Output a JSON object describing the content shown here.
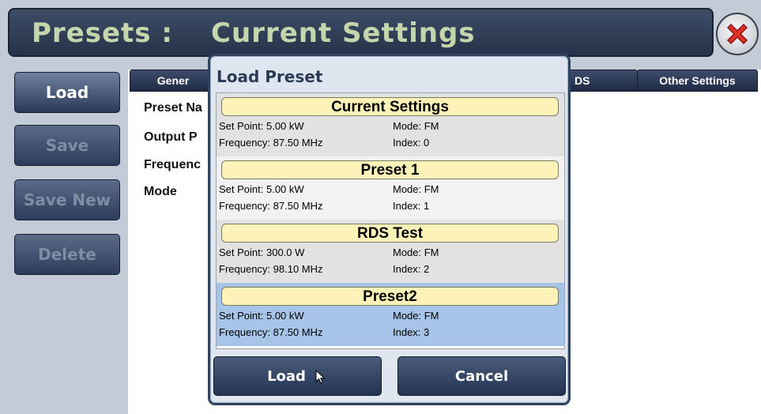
{
  "title": {
    "section": "Presets :",
    "page": "Current Settings"
  },
  "sidebar": {
    "load": "Load",
    "save": "Save",
    "save_new": "Save New",
    "delete": "Delete"
  },
  "tabs": {
    "general": "Gener",
    "rds": "DS",
    "other": "Other Settings"
  },
  "fields": {
    "preset_name": "Preset Na",
    "output_power": "Output P",
    "frequency": "Frequenc",
    "mode": "Mode"
  },
  "dialog": {
    "title": "Load Preset",
    "presets": [
      {
        "name": "Current Settings",
        "set_point": "Set Point: 5.00 kW",
        "mode": "Mode: FM",
        "frequency": "Frequency: 87.50 MHz",
        "index": "Index: 0"
      },
      {
        "name": "Preset 1",
        "set_point": "Set Point: 5.00 kW",
        "mode": "Mode: FM",
        "frequency": "Frequency: 87.50 MHz",
        "index": "Index: 1"
      },
      {
        "name": "RDS Test",
        "set_point": "Set Point: 300.0 W",
        "mode": "Mode: FM",
        "frequency": "Frequency: 98.10 MHz",
        "index": "Index: 2"
      },
      {
        "name": "Preset2",
        "set_point": "Set Point: 5.00 kW",
        "mode": "Mode: FM",
        "frequency": "Frequency: 87.50 MHz",
        "index": "Index: 3"
      }
    ],
    "selected_index": 3,
    "load_label": "Load",
    "cancel_label": "Cancel"
  },
  "colors": {
    "row_a": "#e2e2e2",
    "row_b": "#f2f2f2",
    "selected": "#a6c4e8",
    "name_bg": "#fdf2b8"
  },
  "icons": {
    "close": "close-icon",
    "cursor": "mouse-pointer-icon"
  }
}
